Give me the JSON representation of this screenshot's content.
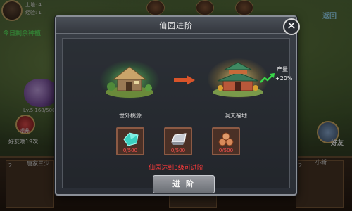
{
  "hud": {
    "land_label": "土地:",
    "land_value": "4",
    "exp_label": "经验:",
    "exp_value": "1",
    "return_label": "返回",
    "today_text": "今日剩余种植",
    "level_text": "Lv.5 168/500",
    "feed_label": "喂养",
    "friend_feed_text": "好友喂19次",
    "right_char_label": "好友"
  },
  "bottom": {
    "slot_numbers": [
      "2",
      "2",
      "2"
    ],
    "left_name": "唐家三少",
    "right_name": "小新"
  },
  "modal": {
    "title": "仙园进阶",
    "close_symbol": "✕",
    "current_garden_name": "世外桃源",
    "next_garden_name": "洞天福地",
    "yield_label": "产量",
    "yield_value": "+20%",
    "materials": [
      {
        "icon": "jade-crystal-icon",
        "count": "0/500"
      },
      {
        "icon": "silver-ingot-icon",
        "count": "0/500"
      },
      {
        "icon": "wood-logs-icon",
        "count": "0/500"
      }
    ],
    "requirement_text": "仙园达到3级可进阶",
    "advance_button_label": "进 阶"
  },
  "colors": {
    "requirement_red": "#ff3a3a",
    "material_count_red": "#ff5050",
    "today_green": "#5ee05e"
  }
}
